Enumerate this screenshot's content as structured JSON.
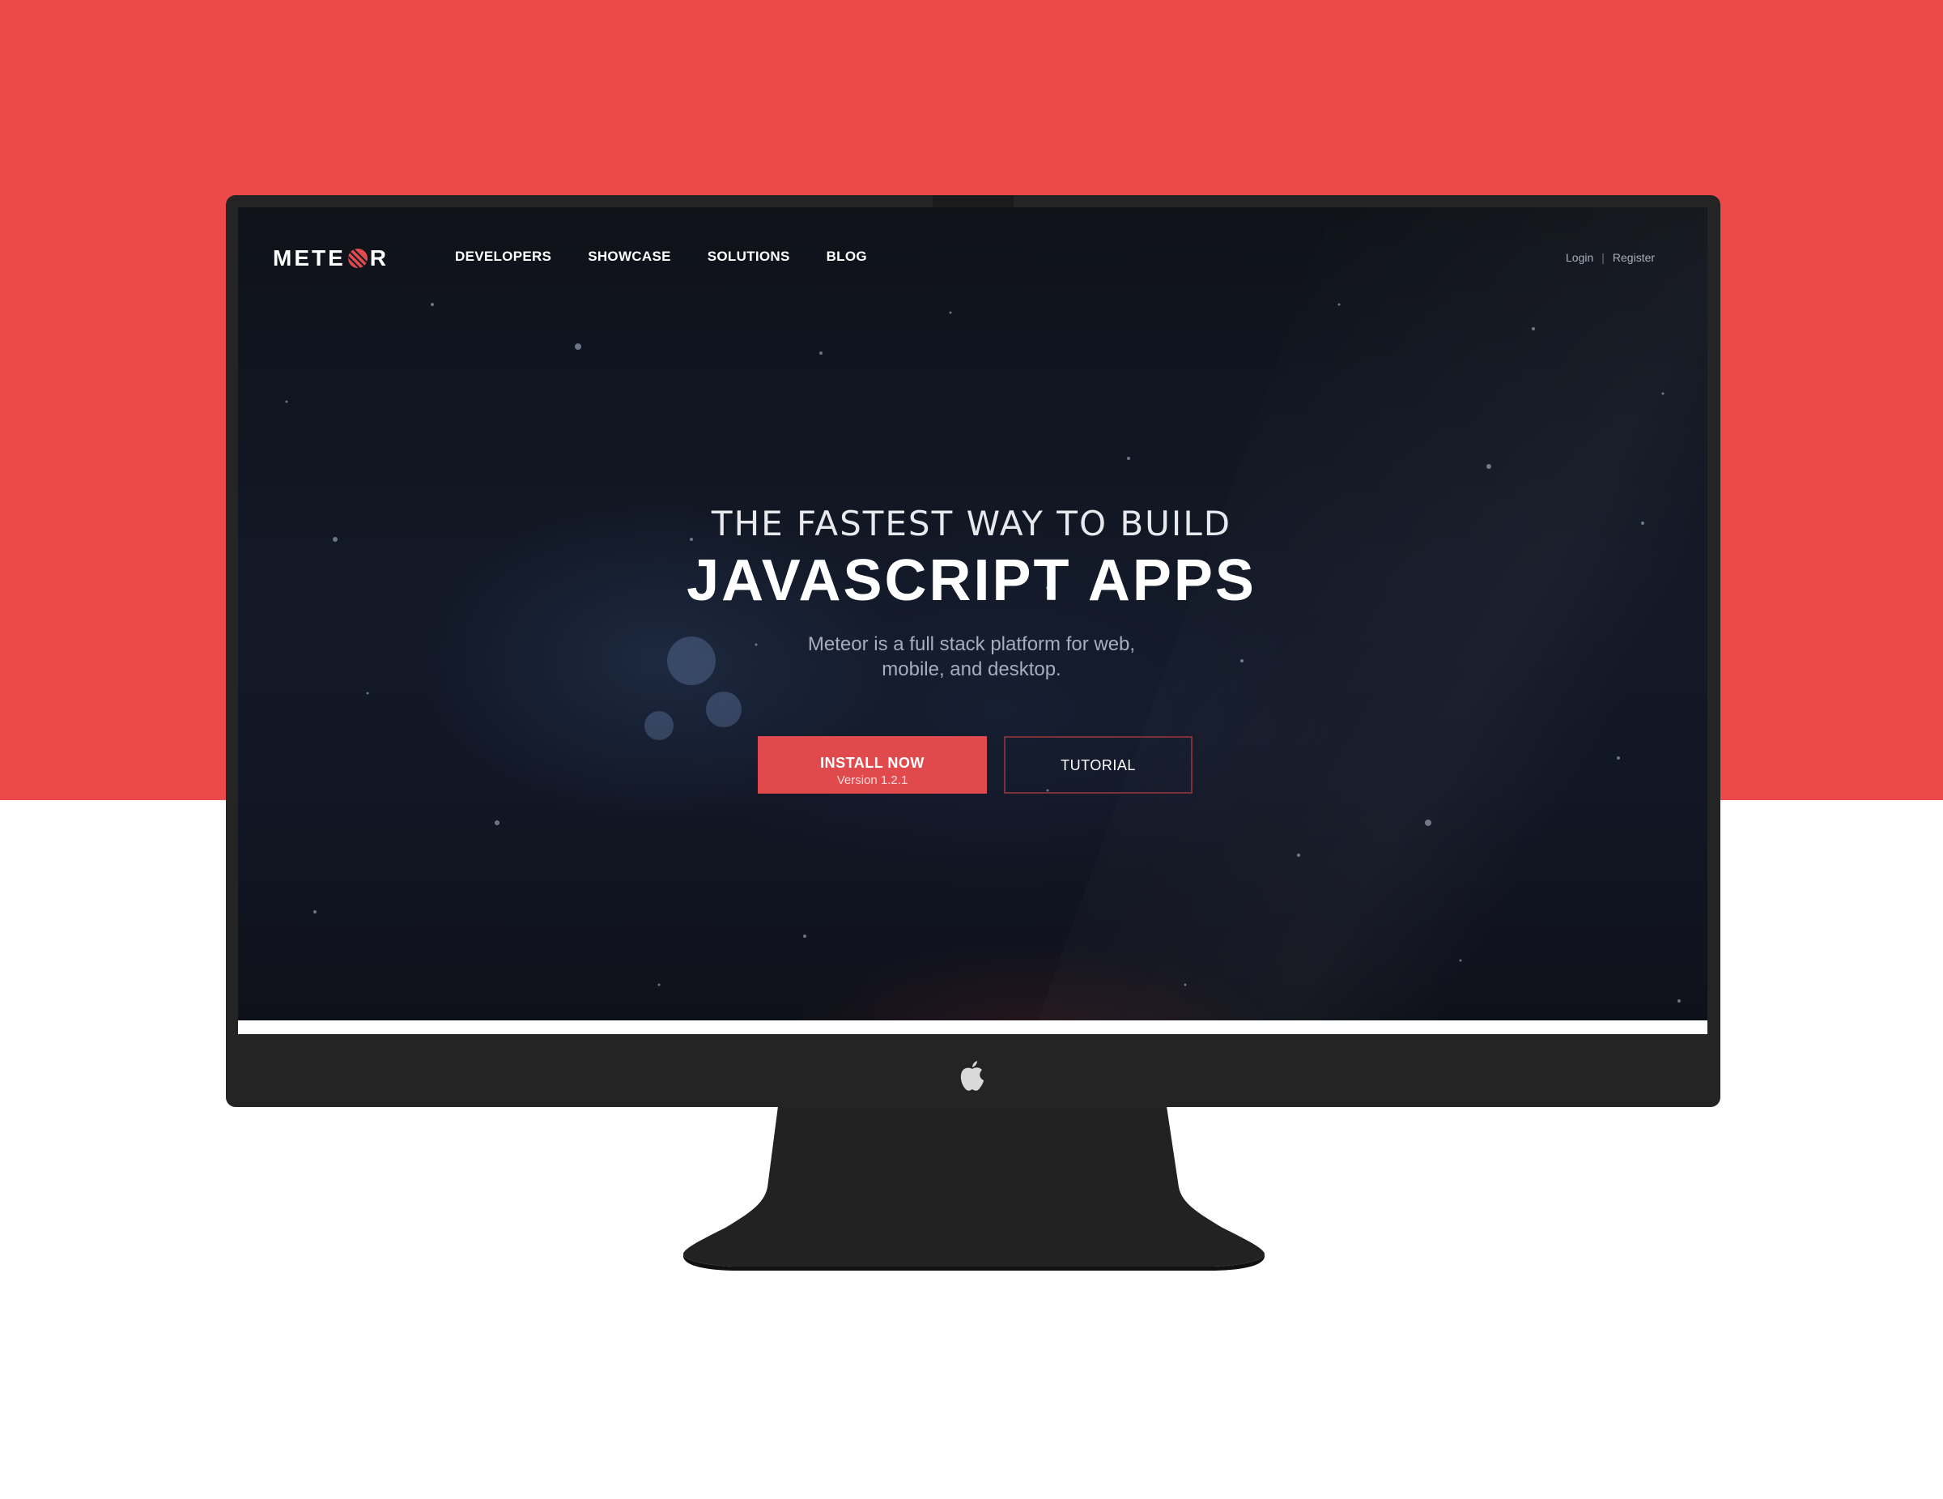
{
  "site": {
    "logo_text_left": "METE",
    "logo_text_right": "R",
    "nav": [
      {
        "label": "DEVELOPERS"
      },
      {
        "label": "SHOWCASE"
      },
      {
        "label": "SOLUTIONS"
      },
      {
        "label": "BLOG"
      }
    ],
    "auth": {
      "login": "Login",
      "separator": "|",
      "register": "Register"
    }
  },
  "hero": {
    "kicker": "THE FASTEST WAY TO BUILD",
    "headline": "JAVASCRIPT APPS",
    "subtitle_line1": "Meteor is a full stack platform for web,",
    "subtitle_line2": "mobile, and desktop.",
    "install_button": {
      "label": "INSTALL NOW",
      "version": "Version 1.2.1"
    },
    "tutorial_button": {
      "label": "TUTORIAL"
    }
  },
  "colors": {
    "background_red": "#ec4a4a",
    "accent_button": "#e04a4c",
    "screen_dark": "#121826",
    "monitor_frame": "#242424"
  },
  "icons": {
    "logo_mark": "meteor-streak-icon",
    "device_logo": "apple-icon"
  }
}
